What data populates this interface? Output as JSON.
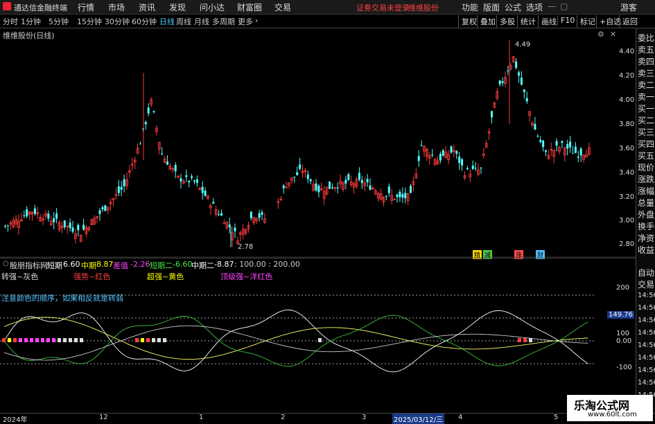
{
  "menubar": {
    "app_name": "通达信金融终端",
    "menus": [
      "行情",
      "市场",
      "资讯",
      "发现",
      "问小达",
      "财富圈",
      "交易"
    ],
    "notice": "证劵交易未登录",
    "stock_name": "维维股份",
    "right_menus": [
      "功能",
      "版面",
      "公式",
      "选项"
    ],
    "user": "游客"
  },
  "periods": {
    "items": [
      "分时",
      "1分钟",
      "5分钟",
      "15分钟",
      "30分钟",
      "60分钟",
      "日线",
      "周线",
      "月线",
      "多周期",
      "更多"
    ],
    "active": "日线"
  },
  "toolbar": {
    "items": [
      "复权",
      "叠加",
      "多股",
      "统计",
      "画线",
      "F10",
      "标记",
      "+自选",
      "返回"
    ]
  },
  "main_chart": {
    "title": "维维股份(日线)",
    "y_ticks": [
      "4.40",
      "4.20",
      "4.00",
      "3.80",
      "3.60",
      "3.40",
      "3.20",
      "3.00",
      "2.80"
    ],
    "high_label": "4.49",
    "low_label": "2.78",
    "tags": [
      {
        "text": "精",
        "color": "#ffd700"
      },
      {
        "text": "减",
        "color": "#4ec44e"
      },
      {
        "text": "涨",
        "color": "#ff4d4d"
      },
      {
        "text": "财",
        "color": "#4ec4ff"
      }
    ]
  },
  "chart_data": {
    "type": "candlestick",
    "x": [
      "2024-11",
      "2024-12",
      "2025-01",
      "2025-02",
      "2025-03",
      "2025-04",
      "2025-05"
    ],
    "ylim": [
      2.75,
      4.55
    ],
    "high": 4.49,
    "low": 2.78
  },
  "indicator": {
    "name": "殷朋指标网",
    "params": [
      {
        "label": "短期",
        "value": "6.60",
        "color": "#ffffff"
      },
      {
        "label": "中期",
        "value": "8.87",
        "color": "#ffff00"
      },
      {
        "label": "差值",
        "value": "-2.26",
        "color": "#ff44ff"
      },
      {
        "label": "短期二",
        "value": "-6.60",
        "color": "#4ee44e"
      },
      {
        "label": "中期二",
        "value": "-8.87",
        "color": "#ffffff"
      }
    ],
    "tail": ": 100.00 : 200.00",
    "legend": [
      {
        "text": "转强~灰色",
        "color": "#dddddd"
      },
      {
        "text": "强势~红色",
        "color": "#ff4040"
      },
      {
        "text": "超强~黄色",
        "color": "#ffff00"
      },
      {
        "text": "顶级强~洋红色",
        "color": "#ff44ff"
      }
    ],
    "note": "注意颜色的顺序，如果相反就是转弱",
    "y_ticks": [
      "200",
      "100",
      "0.00",
      "-100"
    ],
    "current_value": "149.76"
  },
  "side_panel": {
    "items": [
      "委比",
      "卖五",
      "卖四",
      "卖三",
      "卖二",
      "卖一",
      "买一",
      "买二",
      "买三",
      "买四",
      "买五",
      "现价",
      "涨跌",
      "涨幅",
      "总量",
      "外盘",
      "换手",
      "净资",
      "收益",
      "自动",
      "交易"
    ],
    "times": [
      "14:56",
      "14:56",
      "14:56",
      "14:56",
      "14:56",
      "14:56",
      "14:56",
      "14:56",
      "14:56"
    ]
  },
  "time_axis": {
    "labels": [
      "2024年",
      "12",
      "1",
      "2",
      "3",
      "2025/03/12/三",
      "4",
      "5"
    ]
  },
  "watermark": {
    "title": "乐淘公式网",
    "url": "www.60lt.com"
  }
}
